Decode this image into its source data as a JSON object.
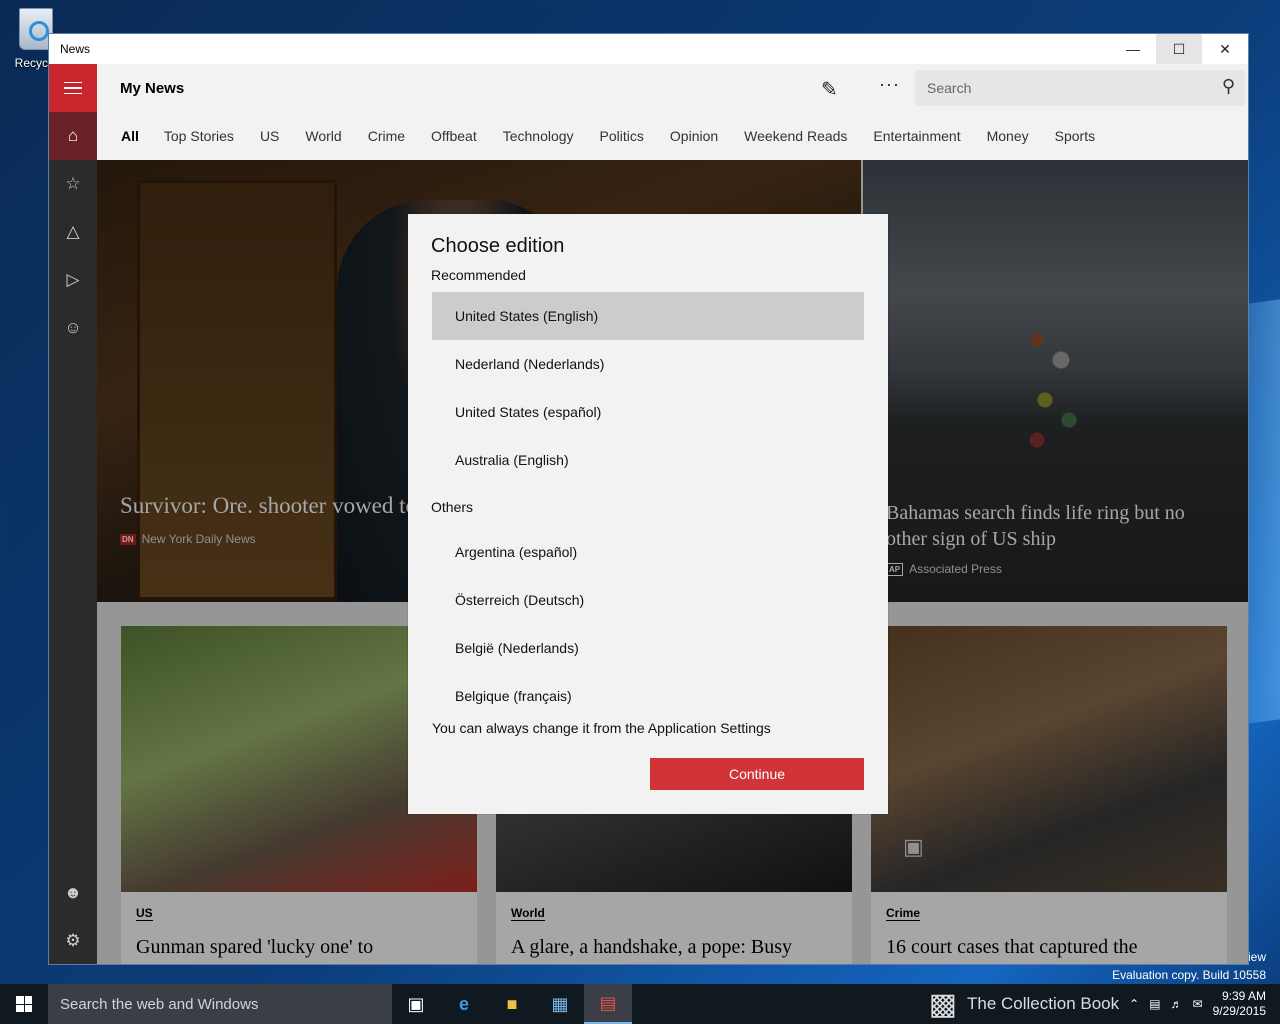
{
  "desktop": {
    "recycle_label": "Recycle",
    "eval_text": "Evaluation copy. Build 10558",
    "preview_text": "eview",
    "watermark": "The Collection Book"
  },
  "window": {
    "title": "News"
  },
  "header": {
    "title": "My News",
    "search_placeholder": "Search"
  },
  "tabs": [
    "All",
    "Top Stories",
    "US",
    "World",
    "Crime",
    "Offbeat",
    "Technology",
    "Politics",
    "Opinion",
    "Weekend Reads",
    "Entertainment",
    "Money",
    "Sports"
  ],
  "hero": {
    "left": {
      "headline": "Survivor: Ore. shooter vowed to take out Christians",
      "source": "New York Daily News",
      "badge": "DN"
    },
    "right": {
      "headline": "Bahamas search finds life ring but no other sign of US ship",
      "source": "Associated Press",
      "badge": "AP"
    }
  },
  "cards": [
    {
      "category": "US",
      "headline": "Gunman spared 'lucky one' to"
    },
    {
      "category": "World",
      "headline": "A glare, a handshake, a pope: Busy"
    },
    {
      "category": "Crime",
      "headline": "16 court cases that captured the"
    }
  ],
  "dialog": {
    "title": "Choose edition",
    "recommended_label": "Recommended",
    "recommended": [
      "United States (English)",
      "Nederland (Nederlands)",
      "United States (español)",
      "Australia (English)"
    ],
    "others_label": "Others",
    "others": [
      "Argentina (español)",
      "Österreich (Deutsch)",
      "België (Nederlands)",
      "Belgique (français)"
    ],
    "note": "You can always change it from the Application Settings",
    "continue_label": "Continue",
    "selected": "United States (English)"
  },
  "taskbar": {
    "search_placeholder": "Search the web and Windows",
    "time": "9:39 AM",
    "date": "9/29/2015"
  },
  "colors": {
    "accent": "#d13438",
    "sidebar": "#2b2b2b",
    "taskbar": "#101820"
  }
}
